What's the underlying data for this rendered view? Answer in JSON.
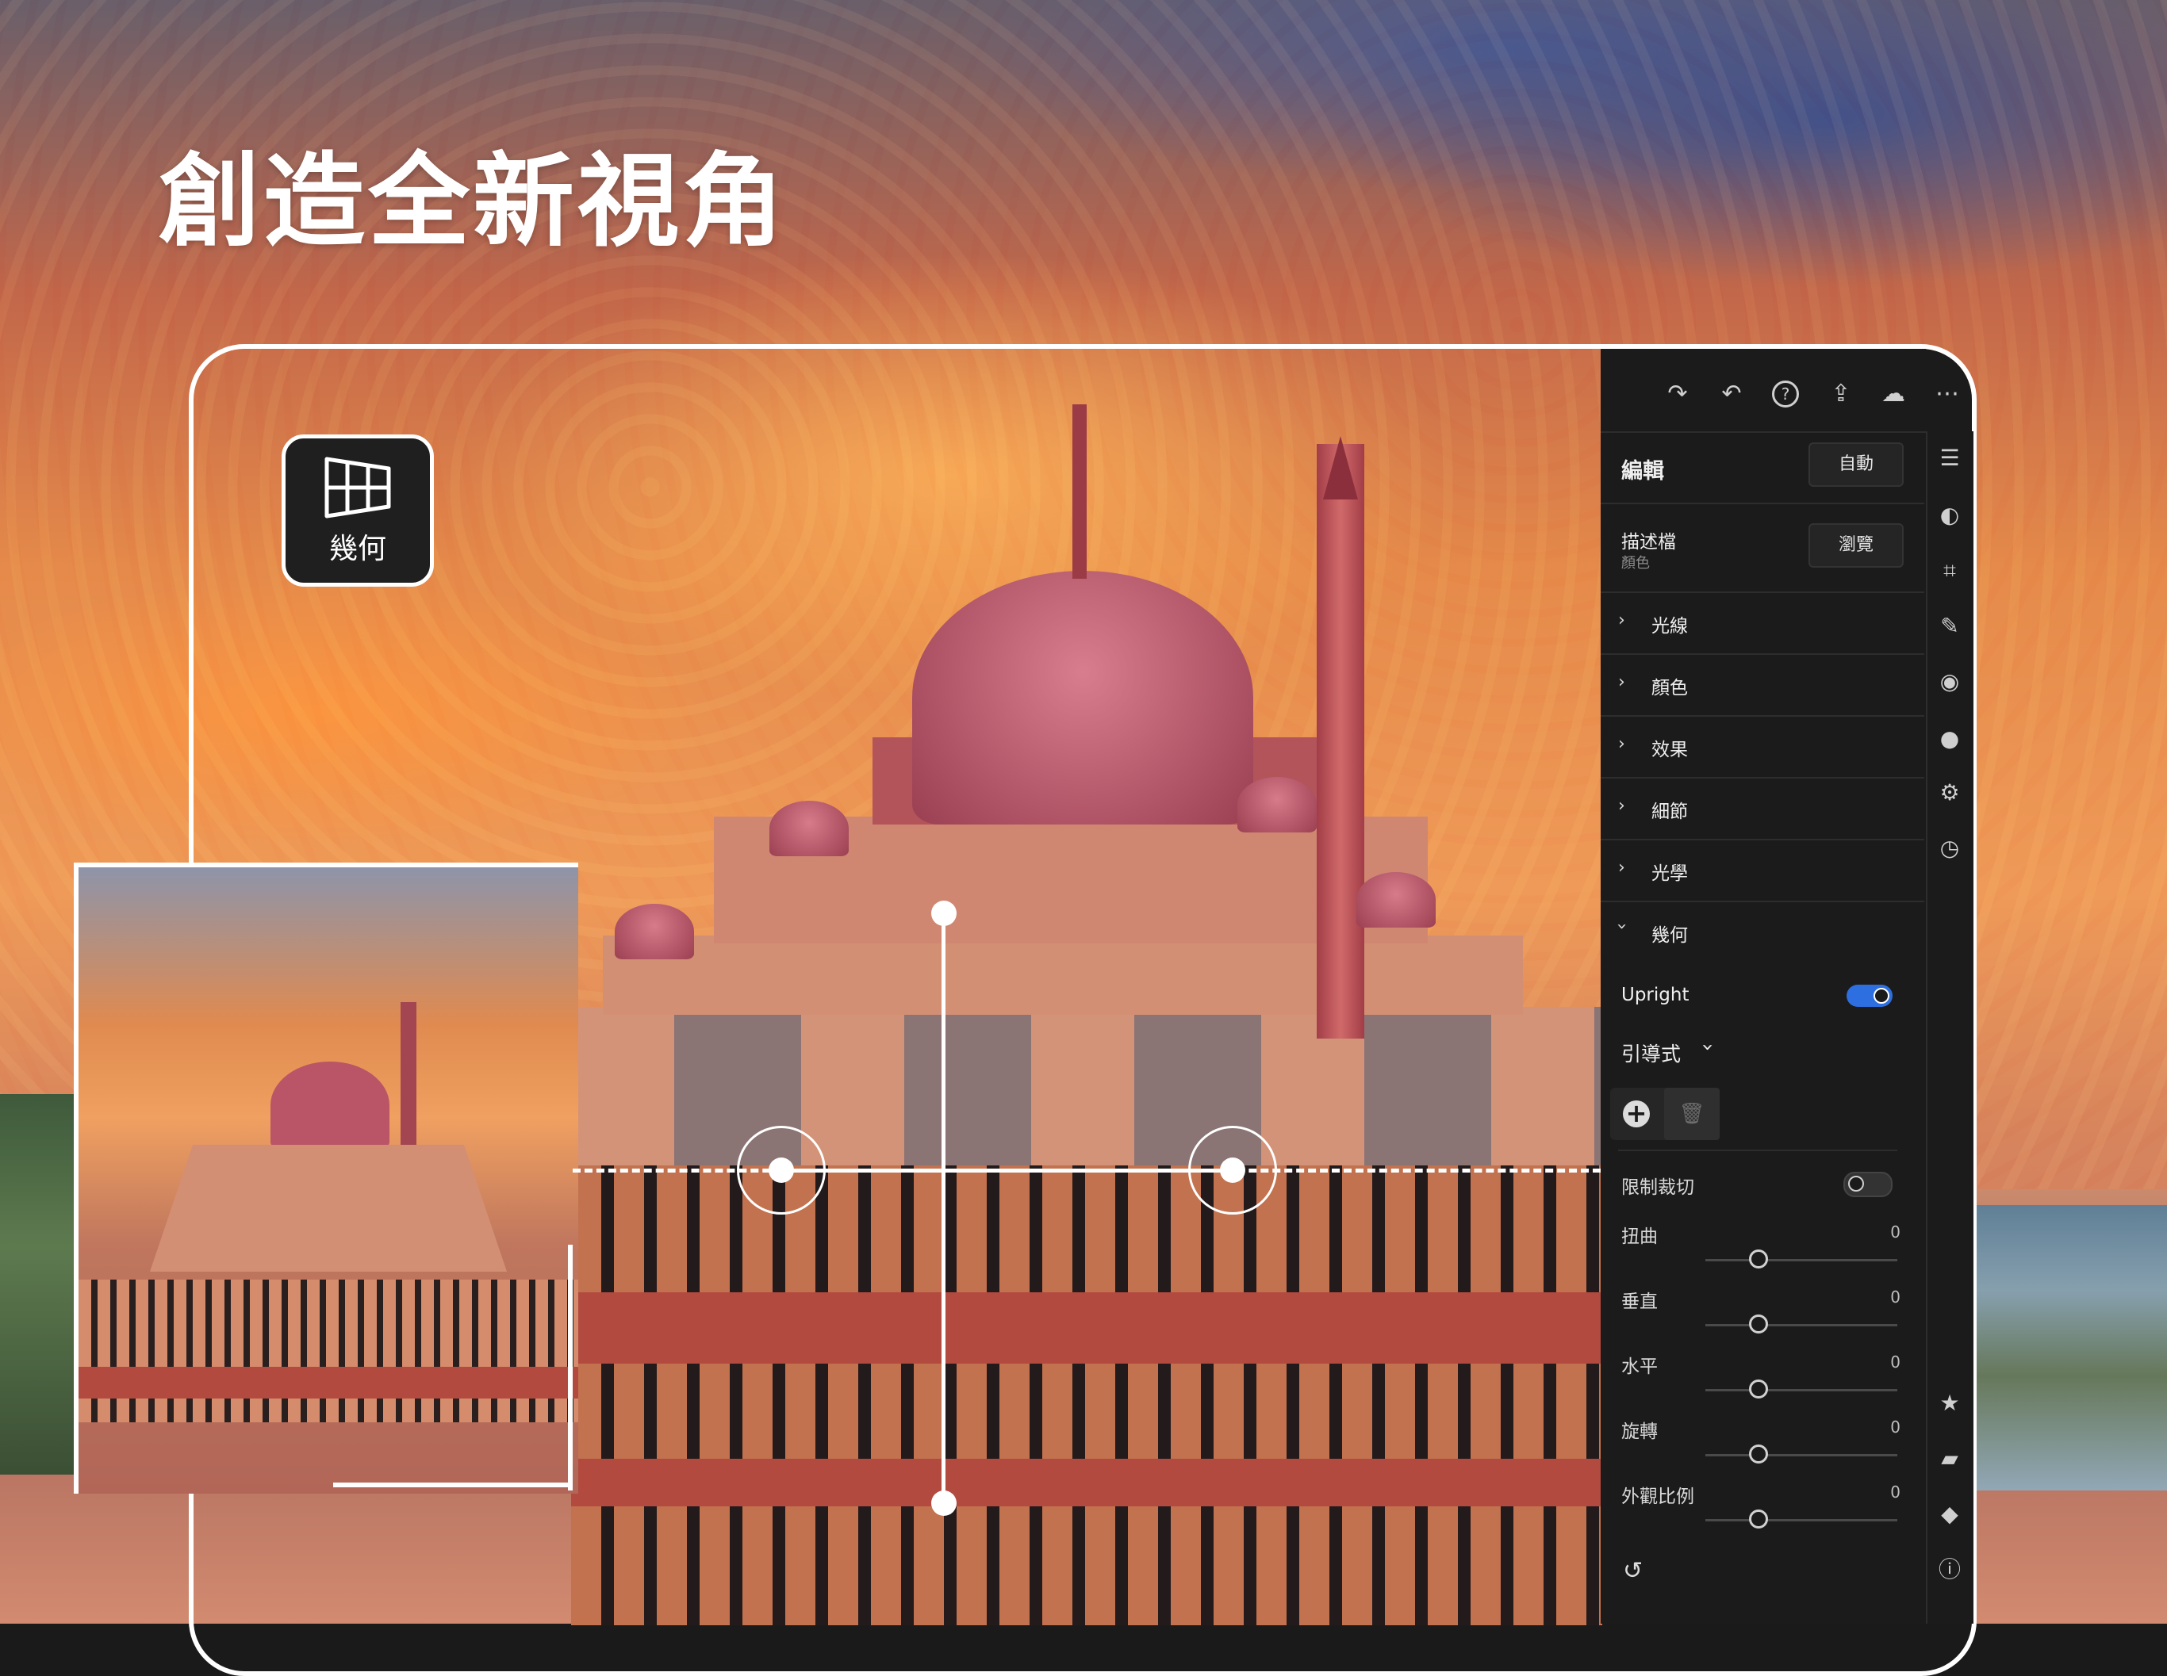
{
  "headline": "創造全新視角",
  "badge": {
    "label": "幾何",
    "icon": "perspective-grid-icon"
  },
  "topbar": {
    "icons": [
      "redo-icon",
      "undo-icon",
      "help-icon",
      "share-icon",
      "cloud-sync-icon",
      "more-icon"
    ]
  },
  "panel": {
    "edit": {
      "title": "編輯",
      "auto_button": "自動"
    },
    "profile": {
      "title": "描述檔",
      "subtitle": "顏色",
      "browse_button": "瀏覽"
    },
    "sections": [
      {
        "label": "光線",
        "expanded": false
      },
      {
        "label": "顏色",
        "expanded": false
      },
      {
        "label": "效果",
        "expanded": false
      },
      {
        "label": "細節",
        "expanded": false
      },
      {
        "label": "光學",
        "expanded": false
      },
      {
        "label": "幾何",
        "expanded": true
      }
    ],
    "geometry": {
      "upright_label": "Upright",
      "upright_on": true,
      "mode_label": "引導式",
      "constrain_label": "限制裁切",
      "constrain_on": false,
      "sliders": [
        {
          "label": "扭曲",
          "value": "0"
        },
        {
          "label": "垂直",
          "value": "0"
        },
        {
          "label": "水平",
          "value": "0"
        },
        {
          "label": "旋轉",
          "value": "0"
        },
        {
          "label": "外觀比例",
          "value": "0"
        }
      ]
    }
  },
  "rail": {
    "icons": [
      "adjust-sliders-icon",
      "presets-icon",
      "crop-icon",
      "healing-brush-icon",
      "masking-icon",
      "color-mixer-icon",
      "versions-icon",
      "history-icon"
    ],
    "bottom_icons": [
      "star-icon",
      "comment-icon",
      "tag-icon",
      "info-icon"
    ]
  },
  "colors": {
    "accent": "#2d6fe0",
    "panel_bg": "#1b1b1b"
  }
}
